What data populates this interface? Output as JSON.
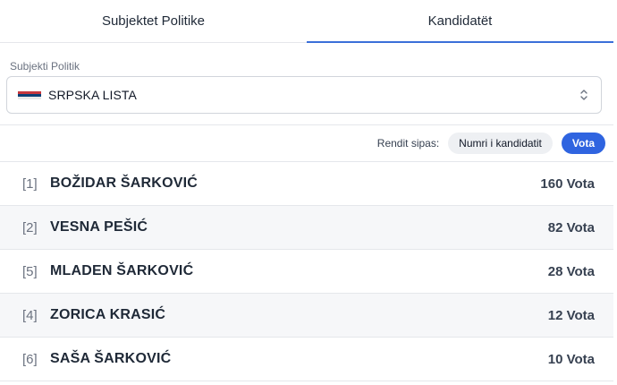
{
  "tabs": [
    {
      "label": "Subjektet Politike",
      "active": false
    },
    {
      "label": "Kandidatët",
      "active": true
    }
  ],
  "select": {
    "label": "Subjekti Politik",
    "value": "SRPSKA LISTA",
    "logo_icon": "srpska-lista-logo-icon"
  },
  "sort": {
    "label": "Rendit sipas:",
    "options": [
      {
        "label": "Numri i kandidatit",
        "selected": false
      },
      {
        "label": "Vota",
        "selected": true
      }
    ]
  },
  "candidates": [
    {
      "number": "[1]",
      "name": "BOŽIDAR ŠARKOVIĆ",
      "votes": "160 Vota"
    },
    {
      "number": "[2]",
      "name": "VESNA PEŠIĆ",
      "votes": "82 Vota"
    },
    {
      "number": "[5]",
      "name": "MLADEN ŠARKOVIĆ",
      "votes": "28 Vota"
    },
    {
      "number": "[4]",
      "name": "ZORICA KRASIĆ",
      "votes": "12 Vota"
    },
    {
      "number": "[6]",
      "name": "SAŠA ŠARKOVIĆ",
      "votes": "10 Vota"
    }
  ],
  "colors": {
    "accent": "#2f64e0",
    "tab_underline": "#3b6fd9",
    "logo_red": "#c6363c",
    "logo_blue": "#0c4076"
  }
}
